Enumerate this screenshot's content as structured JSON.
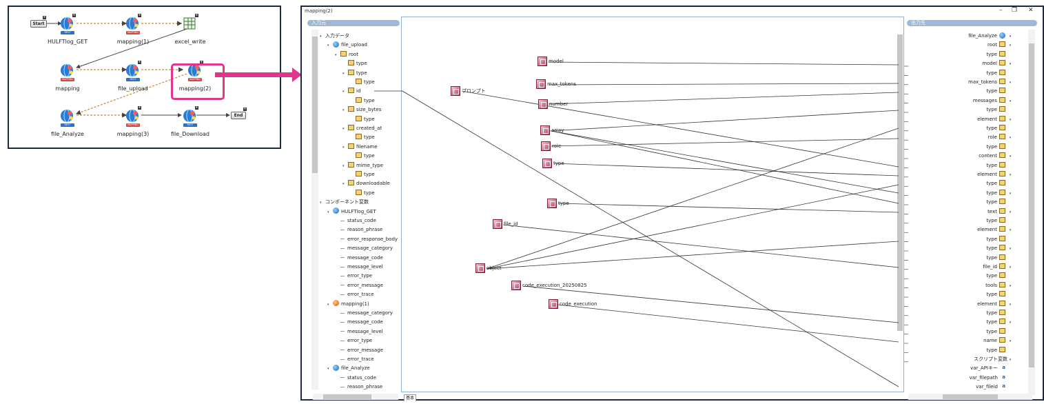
{
  "flow": {
    "start_label": "Start",
    "end_label": "End",
    "rest_tag": "REST",
    "map_tag": "MAPPING",
    "nodes": {
      "hulftlog_get": "HULFTlog_GET",
      "mapping1": "mapping(1)",
      "excel_write": "excel_write",
      "mapping": "mapping",
      "file_upload": "file_upload",
      "mapping2": "mapping(2)",
      "file_analyze": "file_Analyze",
      "mapping3": "mapping(3)",
      "file_download": "file_Download"
    }
  },
  "window": {
    "title": "mapping(2)",
    "minimize": "–",
    "restore": "❐",
    "close": "✕",
    "input_header": "入力元",
    "output_header": "出力先",
    "bottom_tab": "基本"
  },
  "input_tree": [
    {
      "label": "入力データ",
      "indent": 0,
      "tri": "▾",
      "icon": "none"
    },
    {
      "label": "file_upload",
      "indent": 1,
      "tri": "▾",
      "icon": "globe"
    },
    {
      "label": "root",
      "indent": 2,
      "tri": "▾",
      "icon": "table"
    },
    {
      "label": "type",
      "indent": 3,
      "tri": "",
      "icon": "leaf"
    },
    {
      "label": "type",
      "indent": 3,
      "tri": "▾",
      "icon": "table"
    },
    {
      "label": "type",
      "indent": 4,
      "tri": "",
      "icon": "leaf"
    },
    {
      "label": "id",
      "indent": 3,
      "tri": "▾",
      "icon": "table"
    },
    {
      "label": "type",
      "indent": 4,
      "tri": "",
      "icon": "leaf"
    },
    {
      "label": "size_bytes",
      "indent": 3,
      "tri": "▾",
      "icon": "table"
    },
    {
      "label": "type",
      "indent": 4,
      "tri": "",
      "icon": "leaf"
    },
    {
      "label": "created_at",
      "indent": 3,
      "tri": "▾",
      "icon": "table"
    },
    {
      "label": "type",
      "indent": 4,
      "tri": "",
      "icon": "leaf"
    },
    {
      "label": "filename",
      "indent": 3,
      "tri": "▾",
      "icon": "table"
    },
    {
      "label": "type",
      "indent": 4,
      "tri": "",
      "icon": "leaf"
    },
    {
      "label": "mime_type",
      "indent": 3,
      "tri": "▾",
      "icon": "table"
    },
    {
      "label": "type",
      "indent": 4,
      "tri": "",
      "icon": "leaf"
    },
    {
      "label": "downloadable",
      "indent": 3,
      "tri": "▾",
      "icon": "table"
    },
    {
      "label": "type",
      "indent": 4,
      "tri": "",
      "icon": "leaf"
    },
    {
      "label": "コンポーネント変数",
      "indent": 0,
      "tri": "▾",
      "icon": "none"
    },
    {
      "label": "HULFTlog_GET",
      "indent": 1,
      "tri": "▾",
      "icon": "globe"
    },
    {
      "label": "status_code",
      "indent": 2,
      "tri": "",
      "icon": "line"
    },
    {
      "label": "reason_phrase",
      "indent": 2,
      "tri": "",
      "icon": "line"
    },
    {
      "label": "error_response_body",
      "indent": 2,
      "tri": "",
      "icon": "line"
    },
    {
      "label": "message_category",
      "indent": 2,
      "tri": "",
      "icon": "line"
    },
    {
      "label": "message_code",
      "indent": 2,
      "tri": "",
      "icon": "line"
    },
    {
      "label": "message_level",
      "indent": 2,
      "tri": "",
      "icon": "line"
    },
    {
      "label": "error_type",
      "indent": 2,
      "tri": "",
      "icon": "line"
    },
    {
      "label": "error_message",
      "indent": 2,
      "tri": "",
      "icon": "line"
    },
    {
      "label": "error_trace",
      "indent": 2,
      "tri": "",
      "icon": "line"
    },
    {
      "label": "mapping(1)",
      "indent": 1,
      "tri": "▾",
      "icon": "gmap"
    },
    {
      "label": "message_category",
      "indent": 2,
      "tri": "",
      "icon": "line"
    },
    {
      "label": "message_code",
      "indent": 2,
      "tri": "",
      "icon": "line"
    },
    {
      "label": "message_level",
      "indent": 2,
      "tri": "",
      "icon": "line"
    },
    {
      "label": "error_type",
      "indent": 2,
      "tri": "",
      "icon": "line"
    },
    {
      "label": "error_message",
      "indent": 2,
      "tri": "",
      "icon": "line"
    },
    {
      "label": "error_trace",
      "indent": 2,
      "tri": "",
      "icon": "line"
    },
    {
      "label": "file_Analyze",
      "indent": 1,
      "tri": "▾",
      "icon": "globe"
    },
    {
      "label": "status_code",
      "indent": 2,
      "tri": "",
      "icon": "line"
    },
    {
      "label": "reason_phrase",
      "indent": 2,
      "tri": "",
      "icon": "line"
    }
  ],
  "canvas_boxes": [
    {
      "id": "model",
      "label": "model"
    },
    {
      "id": "max_tokens",
      "label": "max_tokens"
    },
    {
      "id": "number",
      "label": "number"
    },
    {
      "id": "prompt",
      "label": "プロンプト"
    },
    {
      "id": "array",
      "label": "array"
    },
    {
      "id": "role",
      "label": "role"
    },
    {
      "id": "type1",
      "label": "type"
    },
    {
      "id": "type2",
      "label": "type"
    },
    {
      "id": "file_id",
      "label": "file_id"
    },
    {
      "id": "object",
      "label": "object"
    },
    {
      "id": "code_exec_date",
      "label": "code_execution_20250825"
    },
    {
      "id": "code_exec",
      "label": "code_execution"
    }
  ],
  "output_tree": [
    {
      "label": "file_Analyze",
      "icon": "globe",
      "tri": "▾"
    },
    {
      "label": "root",
      "icon": "table",
      "tri": "▾"
    },
    {
      "label": "type",
      "icon": "leaf",
      "tri": ""
    },
    {
      "label": "model",
      "icon": "table",
      "tri": "▾"
    },
    {
      "label": "type",
      "icon": "leaf",
      "tri": ""
    },
    {
      "label": "max_tokens",
      "icon": "table",
      "tri": "▾"
    },
    {
      "label": "type",
      "icon": "leaf",
      "tri": ""
    },
    {
      "label": "messages",
      "icon": "table",
      "tri": "▾"
    },
    {
      "label": "type",
      "icon": "leaf",
      "tri": ""
    },
    {
      "label": "element",
      "icon": "table",
      "tri": "▾"
    },
    {
      "label": "type",
      "icon": "leaf",
      "tri": ""
    },
    {
      "label": "role",
      "icon": "table",
      "tri": "▾"
    },
    {
      "label": "type",
      "icon": "leaf",
      "tri": ""
    },
    {
      "label": "content",
      "icon": "table",
      "tri": "▾"
    },
    {
      "label": "type",
      "icon": "leaf",
      "tri": ""
    },
    {
      "label": "element",
      "icon": "table",
      "tri": "▾"
    },
    {
      "label": "type",
      "icon": "leaf",
      "tri": ""
    },
    {
      "label": "type",
      "icon": "table",
      "tri": "▾"
    },
    {
      "label": "type",
      "icon": "leaf",
      "tri": ""
    },
    {
      "label": "text",
      "icon": "table",
      "tri": "▾"
    },
    {
      "label": "type",
      "icon": "leaf",
      "tri": ""
    },
    {
      "label": "element",
      "icon": "table",
      "tri": "▾"
    },
    {
      "label": "type",
      "icon": "leaf",
      "tri": ""
    },
    {
      "label": "type",
      "icon": "table",
      "tri": "▾"
    },
    {
      "label": "type",
      "icon": "leaf",
      "tri": ""
    },
    {
      "label": "file_id",
      "icon": "table",
      "tri": "▾"
    },
    {
      "label": "type",
      "icon": "leaf",
      "tri": ""
    },
    {
      "label": "tools",
      "icon": "table",
      "tri": "▾"
    },
    {
      "label": "type",
      "icon": "leaf",
      "tri": ""
    },
    {
      "label": "element",
      "icon": "table",
      "tri": "▾"
    },
    {
      "label": "type",
      "icon": "leaf",
      "tri": ""
    },
    {
      "label": "type",
      "icon": "table",
      "tri": "▾"
    },
    {
      "label": "type",
      "icon": "leaf",
      "tri": ""
    },
    {
      "label": "name",
      "icon": "table",
      "tri": "▾"
    },
    {
      "label": "type",
      "icon": "leaf",
      "tri": ""
    },
    {
      "label": "スクリプト変数",
      "icon": "none",
      "tri": "▾"
    },
    {
      "label": "var_APIキー",
      "icon": "var",
      "tri": ""
    },
    {
      "label": "var_filepath",
      "icon": "var",
      "tri": ""
    },
    {
      "label": "var_fileid",
      "icon": "var",
      "tri": ""
    }
  ]
}
